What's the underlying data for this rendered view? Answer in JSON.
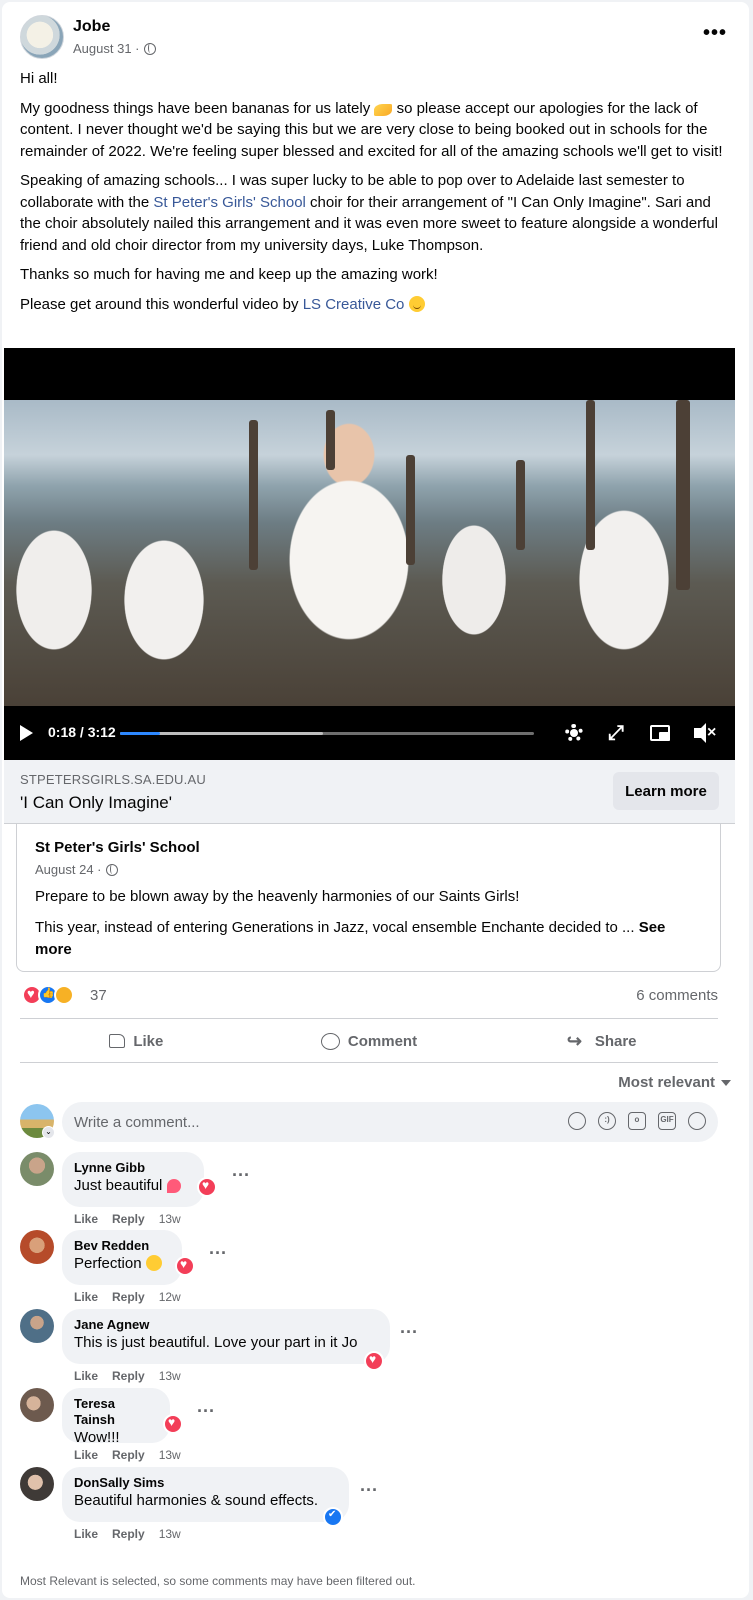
{
  "post": {
    "author": "Jobe",
    "date": "August 31 ·",
    "greeting": "Hi all!",
    "para1_a": "My goodness things have been bananas for us lately ",
    "para1_b": " so please accept our apologies for the lack of content. I never thought we'd be saying this but we are very close to being booked out in schools for the remainder of 2022. We're feeling super blessed and excited for all of the amazing schools we'll get to visit!",
    "para2_a": "Speaking of amazing schools... I was super lucky to be able to pop over to Adelaide last semester to collaborate with the ",
    "para2_link": "St Peter's Girls' School",
    "para2_b": " choir for their arrangement of \"I Can Only Imagine\". Sari and the choir absolutely nailed this arrangement and it was even more sweet to feature alongside a wonderful friend and old choir director from my university days, Luke Thompson.",
    "para3": "Thanks so much for having me and keep up the amazing work!",
    "para4_a": "Please get around this wonderful video by ",
    "para4_link": "LS Creative Co",
    "para4_b": " "
  },
  "video": {
    "time": "0:18 / 3:12",
    "progress": 0.096,
    "buffered": 0.49
  },
  "link_preview": {
    "domain": "STPETERSGIRLS.SA.EDU.AU",
    "title": "'I Can Only Imagine'",
    "button": "Learn more"
  },
  "shared_post": {
    "author": "St Peter's Girls' School",
    "date": "August 24 ·",
    "text1": "Prepare to be blown away by the heavenly harmonies of our Saints Girls!",
    "text2": "This year, instead of entering Generations in Jazz, vocal ensemble Enchante decided to ... ",
    "see_more": "See more"
  },
  "reactions": {
    "count": "37",
    "comments": "6 comments"
  },
  "actions": {
    "like": "Like",
    "comment": "Comment",
    "share": "Share"
  },
  "sort_label": "Most relevant",
  "composer": {
    "placeholder": "Write a comment..."
  },
  "comments": [
    {
      "name": "Lynne Gibb",
      "text": "Just beautiful",
      "like": "Like",
      "reply": "Reply",
      "age": "13w"
    },
    {
      "name": "Bev Redden",
      "text": "Perfection",
      "like": "Like",
      "reply": "Reply",
      "age": "12w"
    },
    {
      "name": "Jane Agnew",
      "text": "This is just beautiful. Love your part in it Jo",
      "like": "Like",
      "reply": "Reply",
      "age": "13w"
    },
    {
      "name": "Teresa Tainsh",
      "text": "Wow!!!",
      "like": "Like",
      "reply": "Reply",
      "age": "13w"
    },
    {
      "name": "DonSally Sims",
      "text": "Beautiful harmonies & sound effects.",
      "like": "Like",
      "reply": "Reply",
      "age": "13w"
    }
  ],
  "footer_note": "Most Relevant is selected, so some comments may have been filtered out.",
  "colors": {
    "link": "#385898",
    "brand_blue": "#1877f2",
    "love_red": "#f33e58"
  }
}
